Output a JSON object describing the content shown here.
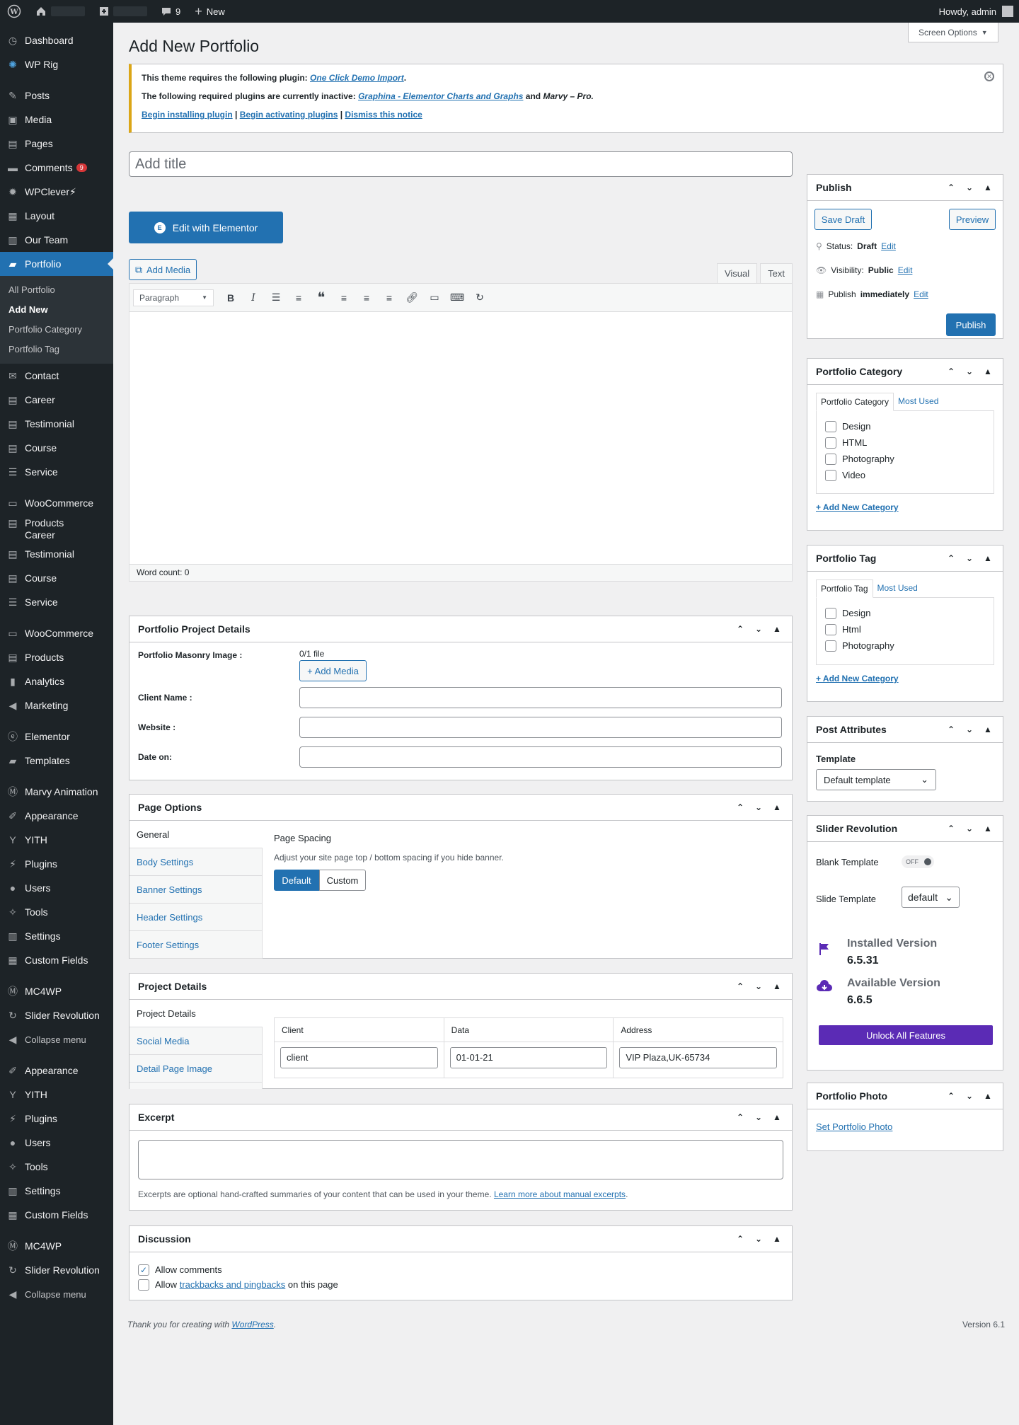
{
  "adminbar": {
    "comments_count": "9",
    "new_label": "New",
    "howdy": "Howdy, admin"
  },
  "sidebar": {
    "items": [
      {
        "label": "Dashboard"
      },
      {
        "label": "WP Rig"
      },
      {
        "label": "Posts"
      },
      {
        "label": "Media"
      },
      {
        "label": "Pages"
      },
      {
        "label": "Comments",
        "badge": "9"
      },
      {
        "label": "WPClever⚡"
      },
      {
        "label": "Layout"
      },
      {
        "label": "Our Team"
      },
      {
        "label": "Portfolio"
      }
    ],
    "submenu": [
      "All Portfolio",
      "Add New",
      "Portfolio Category",
      "Portfolio Tag"
    ],
    "items2": [
      "Contact",
      "Career",
      "Testimonial",
      "Course",
      "Service"
    ],
    "items3": [
      "WooCommerce",
      "Products",
      "Career",
      "Testimonial",
      "Course",
      "Service"
    ],
    "items4": [
      "WooCommerce",
      "Products",
      "Analytics",
      "Marketing"
    ],
    "items5": [
      "Elementor",
      "Templates"
    ],
    "items6": [
      "Marvy Animation",
      "Appearance",
      "YITH",
      "Plugins",
      "Users",
      "Tools",
      "Settings",
      "Custom Fields"
    ],
    "items7": [
      "MC4WP",
      "Slider Revolution",
      "Collapse menu"
    ],
    "items8": [
      "Appearance",
      "YITH",
      "Plugins",
      "Users",
      "Tools",
      "Settings",
      "Custom Fields"
    ],
    "items9": [
      "MC4WP",
      "Slider Revolution",
      "Collapse menu"
    ]
  },
  "page": {
    "title": "Add New Portfolio",
    "screen_options": "Screen Options"
  },
  "notice": {
    "line1_prefix": "This theme requires the following plugin:",
    "line1_link": "One Click Demo Import",
    "line2_prefix": "The following required plugins are currently inactive:",
    "line2_link": "Graphina - Elementor Charts and Graphs",
    "line2_and": "and",
    "line2_end": "Marvy – Pro.",
    "link_install": "Begin installing plugin",
    "link_activate": "Begin activating plugins",
    "link_dismiss": "Dismiss this notice"
  },
  "editor": {
    "title_placeholder": "Add title",
    "elementor_label": "Edit with Elementor",
    "add_media": "Add Media",
    "tab_visual": "Visual",
    "tab_text": "Text",
    "paragraph": "Paragraph",
    "word_count": "Word count: 0"
  },
  "project_details_box": {
    "title": "Portfolio Project Details",
    "masonry_label": "Portfolio Masonry Image :",
    "file_count": "0/1 file",
    "add_media": "+ Add Media",
    "client_label": "Client Name :",
    "website_label": "Website :",
    "date_label": "Date on:"
  },
  "page_options": {
    "title": "Page Options",
    "tabs": [
      "General",
      "Body Settings",
      "Banner Settings",
      "Header Settings",
      "Footer Settings"
    ],
    "spacing_title": "Page Spacing",
    "spacing_desc": "Adjust your site page top / bottom spacing if you hide banner.",
    "btn_default": "Default",
    "btn_custom": "Custom"
  },
  "project_details": {
    "title": "Project Details",
    "tabs": [
      "Project Details",
      "Social Media",
      "Detail Page Image"
    ],
    "headers": [
      "Client",
      "Data",
      "Address"
    ],
    "values": [
      "client",
      "01-01-21",
      "VIP Plaza,UK-65734"
    ]
  },
  "excerpt": {
    "title": "Excerpt",
    "help": "Excerpts are optional hand-crafted summaries of your content that can be used in your theme.",
    "link": "Learn more about manual excerpts"
  },
  "discussion": {
    "title": "Discussion",
    "allow_comments": "Allow comments",
    "allow_prefix": "Allow",
    "trackbacks_link": "trackbacks and pingbacks",
    "allow_suffix": "on this page"
  },
  "publish": {
    "title": "Publish",
    "save_draft": "Save Draft",
    "preview": "Preview",
    "status_label": "Status:",
    "status_value": "Draft",
    "visibility_label": "Visibility:",
    "visibility_value": "Public",
    "publish_label": "Publish",
    "publish_value": "immediately",
    "edit": "Edit",
    "publish_btn": "Publish"
  },
  "portfolio_category": {
    "title": "Portfolio Category",
    "tab_all": "Portfolio Category",
    "tab_used": "Most Used",
    "items": [
      "Design",
      "HTML",
      "Photography",
      "Video"
    ],
    "add_new": "+ Add New Category"
  },
  "portfolio_tag": {
    "title": "Portfolio Tag",
    "tab_all": "Portfolio Tag",
    "tab_used": "Most Used",
    "items": [
      "Design",
      "Html",
      "Photography"
    ],
    "add_new": "+ Add New Category"
  },
  "post_attributes": {
    "title": "Post Attributes",
    "template_label": "Template",
    "template_value": "Default template"
  },
  "slider_revolution": {
    "title": "Slider Revolution",
    "blank_label": "Blank Template",
    "toggle": "OFF",
    "slide_label": "Slide Template",
    "slide_value": "default",
    "installed_label": "Installed Version",
    "installed_value": "6.5.31",
    "available_label": "Available Version",
    "available_value": "6.6.5",
    "unlock": "Unlock All Features"
  },
  "portfolio_photo": {
    "title": "Portfolio Photo",
    "link": "Set Portfolio Photo"
  },
  "footer": {
    "thanks_prefix": "Thank you for creating with",
    "wp_link": "WordPress",
    "version": "Version 6.1"
  },
  "colors": {
    "accent": "#2271b1",
    "sidebar_bg": "#1d2327",
    "notice_border": "#dba617",
    "slider_purple": "#5b2bb5"
  }
}
